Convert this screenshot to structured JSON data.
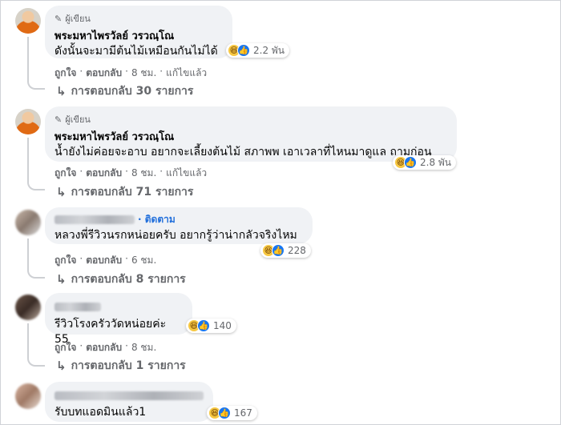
{
  "comments": [
    {
      "badge": "ผู้เขียน",
      "name": "พระมหาไพรวัลย์ วรวณฺโณ",
      "text": "ดังนั้นจะมามีต้นไม้เหมือนกันไม่ได้",
      "reaction_count": "2.2 พัน",
      "actions": [
        "ถูกใจ",
        "ตอบกลับ",
        "8 ชม.",
        "แก้ไขแล้ว"
      ],
      "replies": "การตอบกลับ 30 รายการ"
    },
    {
      "badge": "ผู้เขียน",
      "name": "พระมหาไพรวัลย์ วรวณฺโณ",
      "text": "น้ำยังไม่ค่อยจะอาบ อยากจะเลี้ยงต้นไม้ สภาพพ เอาเวลาที่ไหนมาดูแล ถามก่อน",
      "reaction_count": "2.8 พัน",
      "actions": [
        "ถูกใจ",
        "ตอบกลับ",
        "8 ชม.",
        "แก้ไขแล้ว"
      ],
      "replies": "การตอบกลับ 71 รายการ"
    },
    {
      "follow": "ติดตาม",
      "text": "หลวงพี่รีวิวนรกหน่อยครับ อยากรู้ว่าน่ากลัวจริงไหม",
      "reaction_count": "228",
      "actions": [
        "ถูกใจ",
        "ตอบกลับ",
        "6 ชม."
      ],
      "replies": "การตอบกลับ 8 รายการ"
    },
    {
      "text": "รีวิวโรงครัววัดหน่อยค่ะ 55",
      "reaction_count": "140",
      "actions": [
        "ถูกใจ",
        "ตอบกลับ",
        "8 ชม."
      ],
      "replies": "การตอบกลับ 1 รายการ"
    },
    {
      "text": "รับบทแอดมินแล้ว1",
      "reaction_count": "167"
    }
  ],
  "icons": {
    "pen": "pencil-icon",
    "reply_arrow": "reply-arrow-icon",
    "haha": "haha-reaction-icon",
    "like": "like-reaction-icon"
  },
  "colors": {
    "bubble": "#f0f2f5",
    "link_blue": "#216fdb",
    "meta_gray": "#65676b",
    "like_blue": "#1877f2"
  }
}
